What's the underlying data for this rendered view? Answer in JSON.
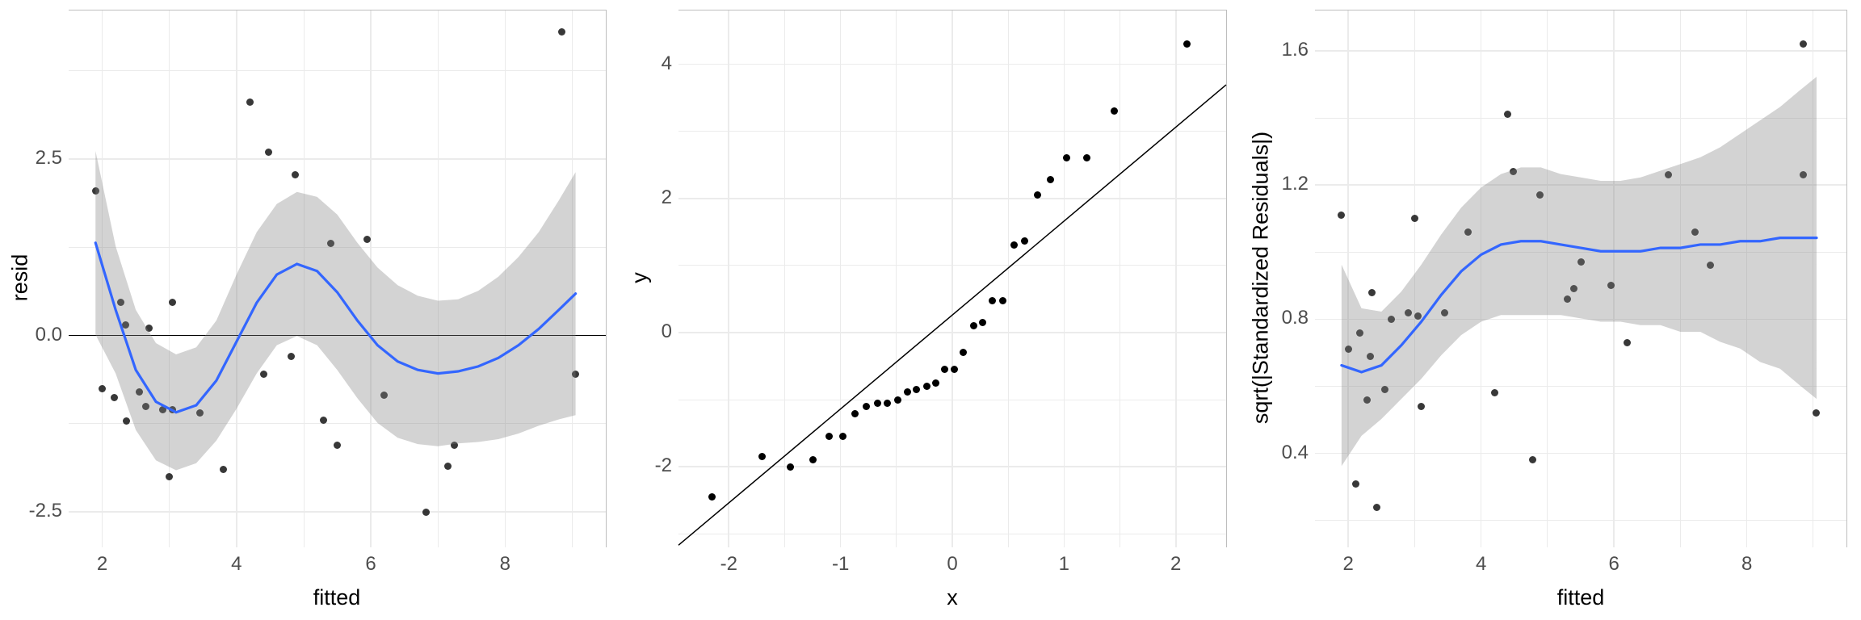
{
  "chart_data": [
    {
      "type": "scatter",
      "xlabel": "fitted",
      "ylabel": "resid",
      "xlim": [
        1.5,
        9.5
      ],
      "ylim": [
        -3.0,
        4.6
      ],
      "xticks": [
        2,
        4,
        6,
        8
      ],
      "yticks": [
        -2.5,
        0.0,
        2.5
      ],
      "hline": 0,
      "points": [
        {
          "x": 1.9,
          "y": 2.05
        },
        {
          "x": 2.0,
          "y": -0.75
        },
        {
          "x": 2.18,
          "y": -0.88
        },
        {
          "x": 2.28,
          "y": 0.47
        },
        {
          "x": 2.36,
          "y": -1.21
        },
        {
          "x": 2.35,
          "y": 0.15
        },
        {
          "x": 2.55,
          "y": -0.8
        },
        {
          "x": 2.65,
          "y": -1.0
        },
        {
          "x": 2.7,
          "y": 0.1
        },
        {
          "x": 2.9,
          "y": -1.05
        },
        {
          "x": 3.0,
          "y": -2.0
        },
        {
          "x": 3.05,
          "y": -1.05
        },
        {
          "x": 3.05,
          "y": 0.47
        },
        {
          "x": 3.45,
          "y": -1.1
        },
        {
          "x": 3.8,
          "y": -1.9
        },
        {
          "x": 4.2,
          "y": 3.3
        },
        {
          "x": 4.4,
          "y": -0.55
        },
        {
          "x": 4.48,
          "y": 2.6
        },
        {
          "x": 4.82,
          "y": -0.3
        },
        {
          "x": 4.88,
          "y": 2.28
        },
        {
          "x": 5.3,
          "y": -1.2
        },
        {
          "x": 5.4,
          "y": 1.3
        },
        {
          "x": 5.5,
          "y": -1.55
        },
        {
          "x": 5.95,
          "y": 1.36
        },
        {
          "x": 6.2,
          "y": -0.85
        },
        {
          "x": 6.82,
          "y": -2.5
        },
        {
          "x": 7.15,
          "y": -1.85
        },
        {
          "x": 7.25,
          "y": -1.55
        },
        {
          "x": 8.85,
          "y": 4.3
        },
        {
          "x": 9.05,
          "y": -0.55
        }
      ],
      "smooth": [
        {
          "x": 1.9,
          "y": 1.3
        },
        {
          "x": 2.2,
          "y": 0.35
        },
        {
          "x": 2.5,
          "y": -0.5
        },
        {
          "x": 2.8,
          "y": -0.95
        },
        {
          "x": 3.1,
          "y": -1.1
        },
        {
          "x": 3.4,
          "y": -1.0
        },
        {
          "x": 3.7,
          "y": -0.65
        },
        {
          "x": 4.0,
          "y": -0.1
        },
        {
          "x": 4.3,
          "y": 0.45
        },
        {
          "x": 4.6,
          "y": 0.85
        },
        {
          "x": 4.9,
          "y": 1.0
        },
        {
          "x": 5.2,
          "y": 0.9
        },
        {
          "x": 5.5,
          "y": 0.6
        },
        {
          "x": 5.8,
          "y": 0.2
        },
        {
          "x": 6.1,
          "y": -0.15
        },
        {
          "x": 6.4,
          "y": -0.38
        },
        {
          "x": 6.7,
          "y": -0.5
        },
        {
          "x": 7.0,
          "y": -0.55
        },
        {
          "x": 7.3,
          "y": -0.52
        },
        {
          "x": 7.6,
          "y": -0.45
        },
        {
          "x": 7.9,
          "y": -0.33
        },
        {
          "x": 8.2,
          "y": -0.15
        },
        {
          "x": 8.5,
          "y": 0.08
        },
        {
          "x": 8.8,
          "y": 0.35
        },
        {
          "x": 9.05,
          "y": 0.58
        }
      ],
      "se_upper": [
        {
          "x": 1.9,
          "y": 2.6
        },
        {
          "x": 2.2,
          "y": 1.25
        },
        {
          "x": 2.5,
          "y": 0.35
        },
        {
          "x": 2.8,
          "y": -0.12
        },
        {
          "x": 3.1,
          "y": -0.28
        },
        {
          "x": 3.4,
          "y": -0.18
        },
        {
          "x": 3.7,
          "y": 0.2
        },
        {
          "x": 4.0,
          "y": 0.85
        },
        {
          "x": 4.3,
          "y": 1.45
        },
        {
          "x": 4.6,
          "y": 1.85
        },
        {
          "x": 4.9,
          "y": 2.02
        },
        {
          "x": 5.2,
          "y": 1.95
        },
        {
          "x": 5.5,
          "y": 1.7
        },
        {
          "x": 5.8,
          "y": 1.3
        },
        {
          "x": 6.1,
          "y": 0.95
        },
        {
          "x": 6.4,
          "y": 0.7
        },
        {
          "x": 6.7,
          "y": 0.55
        },
        {
          "x": 7.0,
          "y": 0.48
        },
        {
          "x": 7.3,
          "y": 0.5
        },
        {
          "x": 7.6,
          "y": 0.62
        },
        {
          "x": 7.9,
          "y": 0.82
        },
        {
          "x": 8.2,
          "y": 1.1
        },
        {
          "x": 8.5,
          "y": 1.45
        },
        {
          "x": 8.8,
          "y": 1.9
        },
        {
          "x": 9.05,
          "y": 2.3
        }
      ],
      "se_lower": [
        {
          "x": 1.9,
          "y": 0.0
        },
        {
          "x": 2.2,
          "y": -0.55
        },
        {
          "x": 2.5,
          "y": -1.35
        },
        {
          "x": 2.8,
          "y": -1.78
        },
        {
          "x": 3.1,
          "y": -1.92
        },
        {
          "x": 3.4,
          "y": -1.82
        },
        {
          "x": 3.7,
          "y": -1.5
        },
        {
          "x": 4.0,
          "y": -1.05
        },
        {
          "x": 4.3,
          "y": -0.55
        },
        {
          "x": 4.6,
          "y": -0.15
        },
        {
          "x": 4.9,
          "y": -0.02
        },
        {
          "x": 5.2,
          "y": -0.15
        },
        {
          "x": 5.5,
          "y": -0.5
        },
        {
          "x": 5.8,
          "y": -0.9
        },
        {
          "x": 6.1,
          "y": -1.25
        },
        {
          "x": 6.4,
          "y": -1.46
        },
        {
          "x": 6.7,
          "y": -1.55
        },
        {
          "x": 7.0,
          "y": -1.58
        },
        {
          "x": 7.3,
          "y": -1.54
        },
        {
          "x": 7.6,
          "y": -1.52
        },
        {
          "x": 7.9,
          "y": -1.48
        },
        {
          "x": 8.2,
          "y": -1.4
        },
        {
          "x": 8.5,
          "y": -1.29
        },
        {
          "x": 8.8,
          "y": -1.2
        },
        {
          "x": 9.05,
          "y": -1.14
        }
      ]
    },
    {
      "type": "scatter",
      "xlabel": "x",
      "ylabel": "y",
      "xlim": [
        -2.45,
        2.45
      ],
      "ylim": [
        -3.2,
        4.8
      ],
      "xticks": [
        -2,
        -1,
        0,
        1,
        2
      ],
      "yticks": [
        -2,
        0,
        2,
        4
      ],
      "abline": {
        "slope": 1.4,
        "intercept": 0.25
      },
      "points": [
        {
          "x": -2.15,
          "y": -2.45
        },
        {
          "x": -1.7,
          "y": -1.85
        },
        {
          "x": -1.45,
          "y": -2.0
        },
        {
          "x": -1.25,
          "y": -1.9
        },
        {
          "x": -1.1,
          "y": -1.55
        },
        {
          "x": -0.98,
          "y": -1.55
        },
        {
          "x": -0.87,
          "y": -1.21
        },
        {
          "x": -0.77,
          "y": -1.1
        },
        {
          "x": -0.67,
          "y": -1.05
        },
        {
          "x": -0.58,
          "y": -1.05
        },
        {
          "x": -0.49,
          "y": -1.0
        },
        {
          "x": -0.4,
          "y": -0.88
        },
        {
          "x": -0.32,
          "y": -0.85
        },
        {
          "x": -0.23,
          "y": -0.8
        },
        {
          "x": -0.15,
          "y": -0.75
        },
        {
          "x": -0.07,
          "y": -0.55
        },
        {
          "x": 0.02,
          "y": -0.55
        },
        {
          "x": 0.1,
          "y": -0.3
        },
        {
          "x": 0.19,
          "y": 0.1
        },
        {
          "x": 0.27,
          "y": 0.15
        },
        {
          "x": 0.36,
          "y": 0.47
        },
        {
          "x": 0.45,
          "y": 0.47
        },
        {
          "x": 0.55,
          "y": 1.3
        },
        {
          "x": 0.65,
          "y": 1.36
        },
        {
          "x": 0.76,
          "y": 2.05
        },
        {
          "x": 0.88,
          "y": 2.28
        },
        {
          "x": 1.02,
          "y": 2.6
        },
        {
          "x": 1.2,
          "y": 2.6
        },
        {
          "x": 1.45,
          "y": 3.3
        },
        {
          "x": 2.1,
          "y": 4.3
        }
      ]
    },
    {
      "type": "scatter",
      "xlabel": "fitted",
      "ylabel": "sqrt(|Standardized Residuals|)",
      "xlim": [
        1.5,
        9.5
      ],
      "ylim": [
        0.12,
        1.72
      ],
      "xticks": [
        2,
        4,
        6,
        8
      ],
      "yticks": [
        0.4,
        0.8,
        1.2,
        1.6
      ],
      "points": [
        {
          "x": 1.9,
          "y": 1.11
        },
        {
          "x": 2.0,
          "y": 0.71
        },
        {
          "x": 2.12,
          "y": 0.31
        },
        {
          "x": 2.18,
          "y": 0.76
        },
        {
          "x": 2.28,
          "y": 0.56
        },
        {
          "x": 2.33,
          "y": 0.69
        },
        {
          "x": 2.36,
          "y": 0.88
        },
        {
          "x": 2.43,
          "y": 0.24
        },
        {
          "x": 2.55,
          "y": 0.59
        },
        {
          "x": 2.65,
          "y": 0.8
        },
        {
          "x": 2.9,
          "y": 0.82
        },
        {
          "x": 3.0,
          "y": 1.1
        },
        {
          "x": 3.05,
          "y": 0.81
        },
        {
          "x": 3.1,
          "y": 0.54
        },
        {
          "x": 3.45,
          "y": 0.82
        },
        {
          "x": 3.8,
          "y": 1.06
        },
        {
          "x": 4.2,
          "y": 0.58
        },
        {
          "x": 4.4,
          "y": 1.41
        },
        {
          "x": 4.48,
          "y": 1.24
        },
        {
          "x": 4.78,
          "y": 0.38
        },
        {
          "x": 4.88,
          "y": 1.17
        },
        {
          "x": 5.3,
          "y": 0.86
        },
        {
          "x": 5.4,
          "y": 0.89
        },
        {
          "x": 5.5,
          "y": 0.97
        },
        {
          "x": 5.95,
          "y": 0.9
        },
        {
          "x": 6.2,
          "y": 0.73
        },
        {
          "x": 6.82,
          "y": 1.23
        },
        {
          "x": 7.22,
          "y": 1.06
        },
        {
          "x": 7.45,
          "y": 0.96
        },
        {
          "x": 8.85,
          "y": 1.62
        },
        {
          "x": 8.85,
          "y": 1.23
        },
        {
          "x": 9.05,
          "y": 0.52
        }
      ],
      "smooth": [
        {
          "x": 1.9,
          "y": 0.66
        },
        {
          "x": 2.2,
          "y": 0.64
        },
        {
          "x": 2.5,
          "y": 0.66
        },
        {
          "x": 2.8,
          "y": 0.72
        },
        {
          "x": 3.1,
          "y": 0.79
        },
        {
          "x": 3.4,
          "y": 0.87
        },
        {
          "x": 3.7,
          "y": 0.94
        },
        {
          "x": 4.0,
          "y": 0.99
        },
        {
          "x": 4.3,
          "y": 1.02
        },
        {
          "x": 4.6,
          "y": 1.03
        },
        {
          "x": 4.9,
          "y": 1.03
        },
        {
          "x": 5.2,
          "y": 1.02
        },
        {
          "x": 5.5,
          "y": 1.01
        },
        {
          "x": 5.8,
          "y": 1.0
        },
        {
          "x": 6.1,
          "y": 1.0
        },
        {
          "x": 6.4,
          "y": 1.0
        },
        {
          "x": 6.7,
          "y": 1.01
        },
        {
          "x": 7.0,
          "y": 1.01
        },
        {
          "x": 7.3,
          "y": 1.02
        },
        {
          "x": 7.6,
          "y": 1.02
        },
        {
          "x": 7.9,
          "y": 1.03
        },
        {
          "x": 8.2,
          "y": 1.03
        },
        {
          "x": 8.5,
          "y": 1.04
        },
        {
          "x": 8.8,
          "y": 1.04
        },
        {
          "x": 9.05,
          "y": 1.04
        }
      ],
      "se_upper": [
        {
          "x": 1.9,
          "y": 0.96
        },
        {
          "x": 2.2,
          "y": 0.83
        },
        {
          "x": 2.5,
          "y": 0.82
        },
        {
          "x": 2.8,
          "y": 0.88
        },
        {
          "x": 3.1,
          "y": 0.96
        },
        {
          "x": 3.4,
          "y": 1.05
        },
        {
          "x": 3.7,
          "y": 1.13
        },
        {
          "x": 4.0,
          "y": 1.19
        },
        {
          "x": 4.3,
          "y": 1.23
        },
        {
          "x": 4.6,
          "y": 1.25
        },
        {
          "x": 4.9,
          "y": 1.25
        },
        {
          "x": 5.2,
          "y": 1.23
        },
        {
          "x": 5.5,
          "y": 1.22
        },
        {
          "x": 5.8,
          "y": 1.21
        },
        {
          "x": 6.1,
          "y": 1.21
        },
        {
          "x": 6.4,
          "y": 1.22
        },
        {
          "x": 6.7,
          "y": 1.24
        },
        {
          "x": 7.0,
          "y": 1.26
        },
        {
          "x": 7.3,
          "y": 1.28
        },
        {
          "x": 7.6,
          "y": 1.31
        },
        {
          "x": 7.9,
          "y": 1.35
        },
        {
          "x": 8.2,
          "y": 1.39
        },
        {
          "x": 8.5,
          "y": 1.43
        },
        {
          "x": 8.8,
          "y": 1.48
        },
        {
          "x": 9.05,
          "y": 1.52
        }
      ],
      "se_lower": [
        {
          "x": 1.9,
          "y": 0.36
        },
        {
          "x": 2.2,
          "y": 0.45
        },
        {
          "x": 2.5,
          "y": 0.5
        },
        {
          "x": 2.8,
          "y": 0.56
        },
        {
          "x": 3.1,
          "y": 0.62
        },
        {
          "x": 3.4,
          "y": 0.69
        },
        {
          "x": 3.7,
          "y": 0.75
        },
        {
          "x": 4.0,
          "y": 0.79
        },
        {
          "x": 4.3,
          "y": 0.81
        },
        {
          "x": 4.6,
          "y": 0.81
        },
        {
          "x": 4.9,
          "y": 0.81
        },
        {
          "x": 5.2,
          "y": 0.81
        },
        {
          "x": 5.5,
          "y": 0.8
        },
        {
          "x": 5.8,
          "y": 0.79
        },
        {
          "x": 6.1,
          "y": 0.79
        },
        {
          "x": 6.4,
          "y": 0.78
        },
        {
          "x": 6.7,
          "y": 0.78
        },
        {
          "x": 7.0,
          "y": 0.76
        },
        {
          "x": 7.3,
          "y": 0.76
        },
        {
          "x": 7.6,
          "y": 0.73
        },
        {
          "x": 7.9,
          "y": 0.71
        },
        {
          "x": 8.2,
          "y": 0.67
        },
        {
          "x": 8.5,
          "y": 0.65
        },
        {
          "x": 8.8,
          "y": 0.6
        },
        {
          "x": 9.05,
          "y": 0.56
        }
      ]
    }
  ],
  "ytick_labels": {
    "panel0": [
      "-2.5",
      "0.0",
      "2.5"
    ],
    "panel1": [
      "-2",
      "0",
      "2",
      "4"
    ],
    "panel2": [
      "0.4",
      "0.8",
      "1.2",
      "1.6"
    ]
  }
}
